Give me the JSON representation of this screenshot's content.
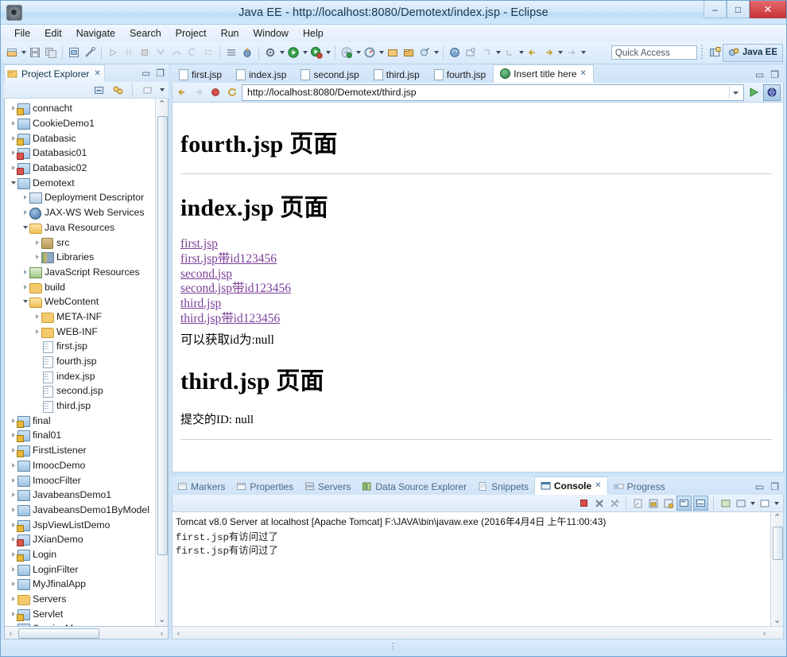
{
  "window": {
    "title": "Java EE - http://localhost:8080/Demotext/index.jsp - Eclipse",
    "minimize": "–",
    "maximize": "□",
    "close": "✕",
    "app_icon": "eclipse-icon"
  },
  "menubar": [
    "File",
    "Edit",
    "Navigate",
    "Search",
    "Project",
    "Run",
    "Window",
    "Help"
  ],
  "toolbar": {
    "quick_access_placeholder": "Quick Access",
    "perspective_label": "Java EE",
    "open_perspective_icon": "open-perspective-icon"
  },
  "project_explorer": {
    "tab_label": "Project Explorer",
    "close_glyph": "✕",
    "minimize_glyph": "▭",
    "maximize_glyph": "❐",
    "tree": [
      {
        "label": "connacht",
        "depth": 0,
        "arrow": "closed",
        "icon": "project-warn"
      },
      {
        "label": "CookieDemo1",
        "depth": 0,
        "arrow": "closed",
        "icon": "project"
      },
      {
        "label": "Databasic",
        "depth": 0,
        "arrow": "closed",
        "icon": "project-warn"
      },
      {
        "label": "Databasic01",
        "depth": 0,
        "arrow": "closed",
        "icon": "project-err"
      },
      {
        "label": "Databasic02",
        "depth": 0,
        "arrow": "closed",
        "icon": "project-err"
      },
      {
        "label": "Demotext",
        "depth": 0,
        "arrow": "open",
        "icon": "project"
      },
      {
        "label": "Deployment Descriptor",
        "depth": 1,
        "arrow": "closed",
        "icon": "deployment-descriptor"
      },
      {
        "label": "JAX-WS Web Services",
        "depth": 1,
        "arrow": "closed",
        "icon": "web-services"
      },
      {
        "label": "Java Resources",
        "depth": 1,
        "arrow": "open",
        "icon": "folder-open"
      },
      {
        "label": "src",
        "depth": 2,
        "arrow": "closed",
        "icon": "source-folder"
      },
      {
        "label": "Libraries",
        "depth": 2,
        "arrow": "closed",
        "icon": "libraries"
      },
      {
        "label": "JavaScript Resources",
        "depth": 1,
        "arrow": "closed",
        "icon": "javascript-resources"
      },
      {
        "label": "build",
        "depth": 1,
        "arrow": "closed",
        "icon": "folder"
      },
      {
        "label": "WebContent",
        "depth": 1,
        "arrow": "open",
        "icon": "folder-open"
      },
      {
        "label": "META-INF",
        "depth": 2,
        "arrow": "closed",
        "icon": "folder"
      },
      {
        "label": "WEB-INF",
        "depth": 2,
        "arrow": "closed",
        "icon": "folder"
      },
      {
        "label": "first.jsp",
        "depth": 2,
        "arrow": "none",
        "icon": "file"
      },
      {
        "label": "fourth.jsp",
        "depth": 2,
        "arrow": "none",
        "icon": "file"
      },
      {
        "label": "index.jsp",
        "depth": 2,
        "arrow": "none",
        "icon": "file"
      },
      {
        "label": "second.jsp",
        "depth": 2,
        "arrow": "none",
        "icon": "file"
      },
      {
        "label": "third.jsp",
        "depth": 2,
        "arrow": "none",
        "icon": "file"
      },
      {
        "label": "final",
        "depth": 0,
        "arrow": "closed",
        "icon": "project-warn"
      },
      {
        "label": "final01",
        "depth": 0,
        "arrow": "closed",
        "icon": "project-warn"
      },
      {
        "label": "FirstListener",
        "depth": 0,
        "arrow": "closed",
        "icon": "project-warn"
      },
      {
        "label": "ImoocDemo",
        "depth": 0,
        "arrow": "closed",
        "icon": "project"
      },
      {
        "label": "ImoocFilter",
        "depth": 0,
        "arrow": "closed",
        "icon": "project"
      },
      {
        "label": "JavabeansDemo1",
        "depth": 0,
        "arrow": "closed",
        "icon": "project"
      },
      {
        "label": "JavabeansDemo1ByModel",
        "depth": 0,
        "arrow": "closed",
        "icon": "project"
      },
      {
        "label": "JspViewListDemo",
        "depth": 0,
        "arrow": "closed",
        "icon": "project-warn"
      },
      {
        "label": "JXianDemo",
        "depth": 0,
        "arrow": "closed",
        "icon": "project-err"
      },
      {
        "label": "Login",
        "depth": 0,
        "arrow": "closed",
        "icon": "project-warn"
      },
      {
        "label": "LoginFilter",
        "depth": 0,
        "arrow": "closed",
        "icon": "project"
      },
      {
        "label": "MyJfinalApp",
        "depth": 0,
        "arrow": "closed",
        "icon": "project"
      },
      {
        "label": "Servers",
        "depth": 0,
        "arrow": "closed",
        "icon": "folder"
      },
      {
        "label": "Servlet",
        "depth": 0,
        "arrow": "closed",
        "icon": "project-warn"
      },
      {
        "label": "ServiceMan",
        "depth": 0,
        "arrow": "closed",
        "icon": "project"
      }
    ]
  },
  "editor": {
    "tabs": [
      {
        "label": "first.jsp",
        "icon": "file-icon",
        "active": false,
        "closable": false
      },
      {
        "label": "index.jsp",
        "icon": "file-icon",
        "active": false,
        "closable": false
      },
      {
        "label": "second.jsp",
        "icon": "file-icon",
        "active": false,
        "closable": false
      },
      {
        "label": "third.jsp",
        "icon": "file-icon",
        "active": false,
        "closable": false
      },
      {
        "label": "fourth.jsp",
        "icon": "file-icon",
        "active": false,
        "closable": false
      },
      {
        "label": "Insert title here",
        "icon": "globe-icon",
        "active": true,
        "closable": true
      }
    ],
    "close_glyph": "✕",
    "minimize_glyph": "▭",
    "maximize_glyph": "❐"
  },
  "browser": {
    "url": "http://localhost:8080/Demotext/third.jsp",
    "back_icon": "back-arrow-icon",
    "forward_icon": "forward-arrow-icon",
    "stop_icon": "stop-icon",
    "refresh_icon": "refresh-icon",
    "dropdown_icon": "chevron-down-icon",
    "go_icon": "go-play-icon",
    "open_external_icon": "open-external-browser-icon"
  },
  "page": {
    "heading_fourth": "fourth.jsp 页面",
    "heading_index": "index.jsp 页面",
    "links": [
      "first.jsp",
      "first.jsp带id123456",
      "second.jsp",
      "second.jsp带id123456",
      "third.jsp",
      "third.jsp带id123456"
    ],
    "id_line": "可以获取id为:null",
    "heading_third": "third.jsp 页面",
    "submitted_id": "提交的ID: null",
    "link_color": "#7b3f98"
  },
  "bottom_panel": {
    "tabs": [
      {
        "label": "Markers",
        "icon": "markers-icon",
        "active": false,
        "closable": false
      },
      {
        "label": "Properties",
        "icon": "properties-icon",
        "active": false,
        "closable": false
      },
      {
        "label": "Servers",
        "icon": "servers-icon",
        "active": false,
        "closable": false
      },
      {
        "label": "Data Source Explorer",
        "icon": "data-source-icon",
        "active": false,
        "closable": false
      },
      {
        "label": "Snippets",
        "icon": "snippets-icon",
        "active": false,
        "closable": false
      },
      {
        "label": "Console",
        "icon": "console-icon",
        "active": true,
        "closable": true
      },
      {
        "label": "Progress",
        "icon": "progress-icon",
        "active": false,
        "closable": false
      }
    ],
    "close_glyph": "✕",
    "minimize_glyph": "▭",
    "maximize_glyph": "❐"
  },
  "console": {
    "header": "Tomcat v8.0 Server at localhost [Apache Tomcat] F:\\JAVA\\bin\\javaw.exe (2016年4月4日 上午11:00:43)",
    "lines": [
      "first.jsp有访问过了",
      "first.jsp有访问过了"
    ]
  },
  "statusbar": {
    "grip": "⋮"
  }
}
